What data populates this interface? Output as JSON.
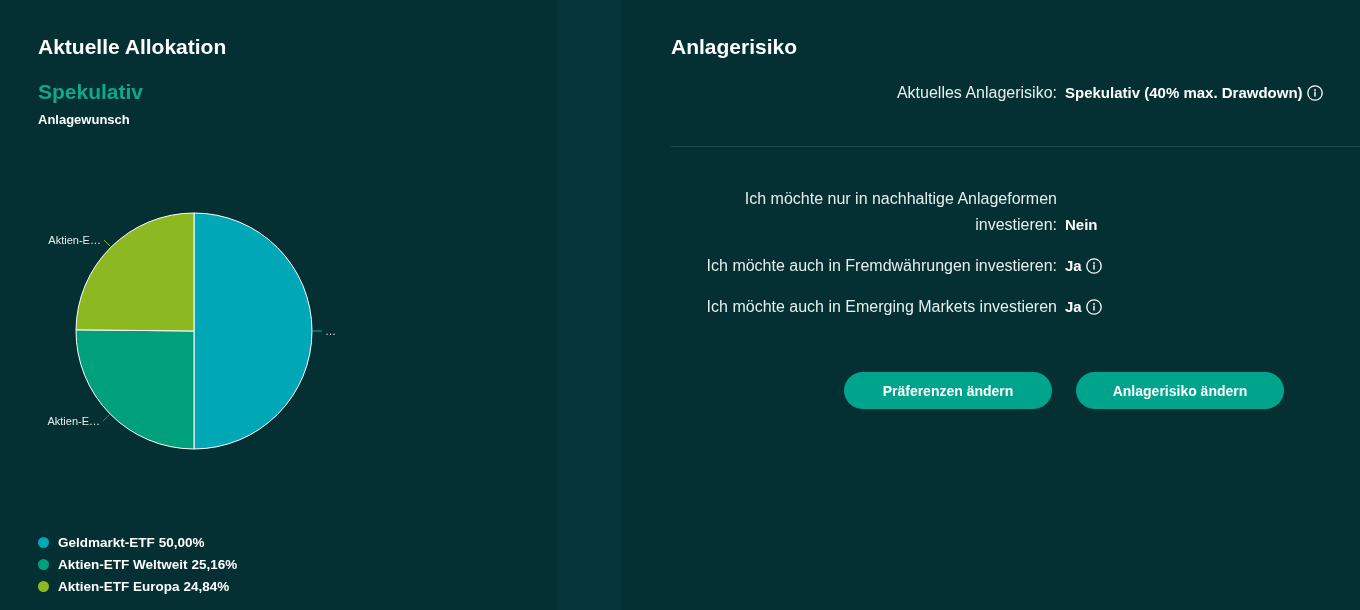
{
  "allocation": {
    "title": "Aktuelle Allokation",
    "risk_profile": "Spekulativ",
    "subtitle": "Anlagewunsch",
    "chart_data": {
      "type": "pie",
      "categories": [
        "Geldmarkt-ETF",
        "Aktien-ETF Weltweit",
        "Aktien-ETF Europa"
      ],
      "values": [
        50.0,
        25.16,
        24.84
      ],
      "value_labels": [
        "…",
        "Aktien-E…",
        "Aktien-E…"
      ]
    },
    "legend": [
      {
        "value": "50,00%",
        "color": "#00a7b6"
      },
      {
        "value": "25,16%",
        "color": "#00a07d"
      },
      {
        "value": "24,84%",
        "color": "#8cb922"
      }
    ]
  },
  "risk": {
    "title": "Anlagerisiko",
    "current": {
      "label": "Aktuelles Anlagerisiko:",
      "value": "Spekulativ (40% max. Drawdown)",
      "info": true
    },
    "preferences": [
      {
        "label": "Ich möchte nur in nachhaltige Anlageformen investieren:",
        "value": "Nein",
        "info": false
      },
      {
        "label": "Ich möchte auch in Fremdwährungen investieren:",
        "value": "Ja",
        "info": true
      },
      {
        "label": "Ich möchte auch in Emerging Markets investieren",
        "value": "Ja",
        "info": true
      }
    ],
    "buttons": [
      {
        "label": "Präferenzen ändern"
      },
      {
        "label": "Anlagerisiko ändern"
      }
    ]
  }
}
